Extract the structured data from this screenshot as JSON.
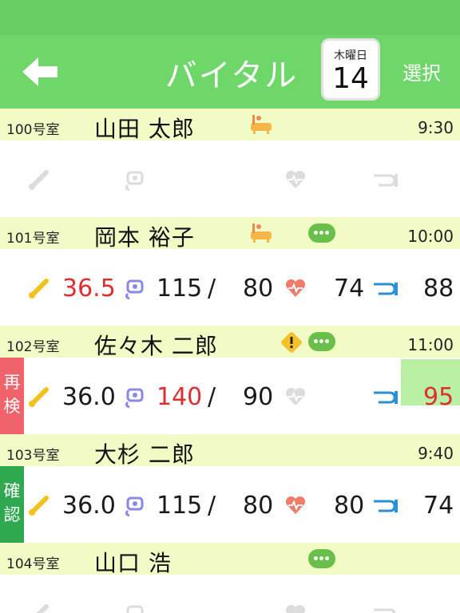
{
  "header": {
    "title": "バイタル",
    "date_dow": "木曜日",
    "date_day": "14",
    "select_label": "選択",
    "back_icon": "back-arrow-icon"
  },
  "colors": {
    "header_green": "#6fd66a",
    "room_bar": "#f2fbc6",
    "alert_red": "#e02e2e",
    "recheck_tag": "#f0636b",
    "confirm_tag": "#2fa84f",
    "pulse_highlight": "#b9f0a3",
    "chat_green": "#6abf4b",
    "bath_orange": "#f4b84a"
  },
  "rooms": [
    {
      "room": "100号室",
      "name": "山田 太郎",
      "time": "9:30",
      "icons": [
        "bath-icon"
      ],
      "vitals": {
        "temp": "",
        "bp_sys": "",
        "bp_dia": "",
        "pulse": "",
        "spo2": ""
      }
    },
    {
      "room": "101号室",
      "name": "岡本 裕子",
      "time": "10:00",
      "icons": [
        "bath-icon",
        "chat-icon"
      ],
      "vitals": {
        "temp": "36.5",
        "bp_sys": "115",
        "bp_sep": "/",
        "bp_dia": "80",
        "pulse": "74",
        "spo2": "88"
      }
    },
    {
      "room": "102号室",
      "name": "佐々木 二郎",
      "time": "11:00",
      "icons": [
        "warning-icon",
        "chat-icon"
      ],
      "tag": "再検",
      "vitals": {
        "temp": "36.0",
        "bp_sys": "140",
        "bp_sep": "/",
        "bp_dia": "90",
        "pulse": "",
        "spo2": "95"
      }
    },
    {
      "room": "103号室",
      "name": "大杉 二郎",
      "time": "9:40",
      "icons": [],
      "tag": "確認",
      "vitals": {
        "temp": "36.0",
        "bp_sys": "115",
        "bp_sep": "/",
        "bp_dia": "80",
        "pulse": "80",
        "spo2": "74"
      }
    },
    {
      "room": "104号室",
      "name": "山口 浩",
      "time": "",
      "icons": [
        "chat-icon"
      ],
      "vitals": {
        "temp": "",
        "bp_sys": "",
        "bp_dia": "",
        "pulse": "",
        "spo2": ""
      }
    }
  ]
}
